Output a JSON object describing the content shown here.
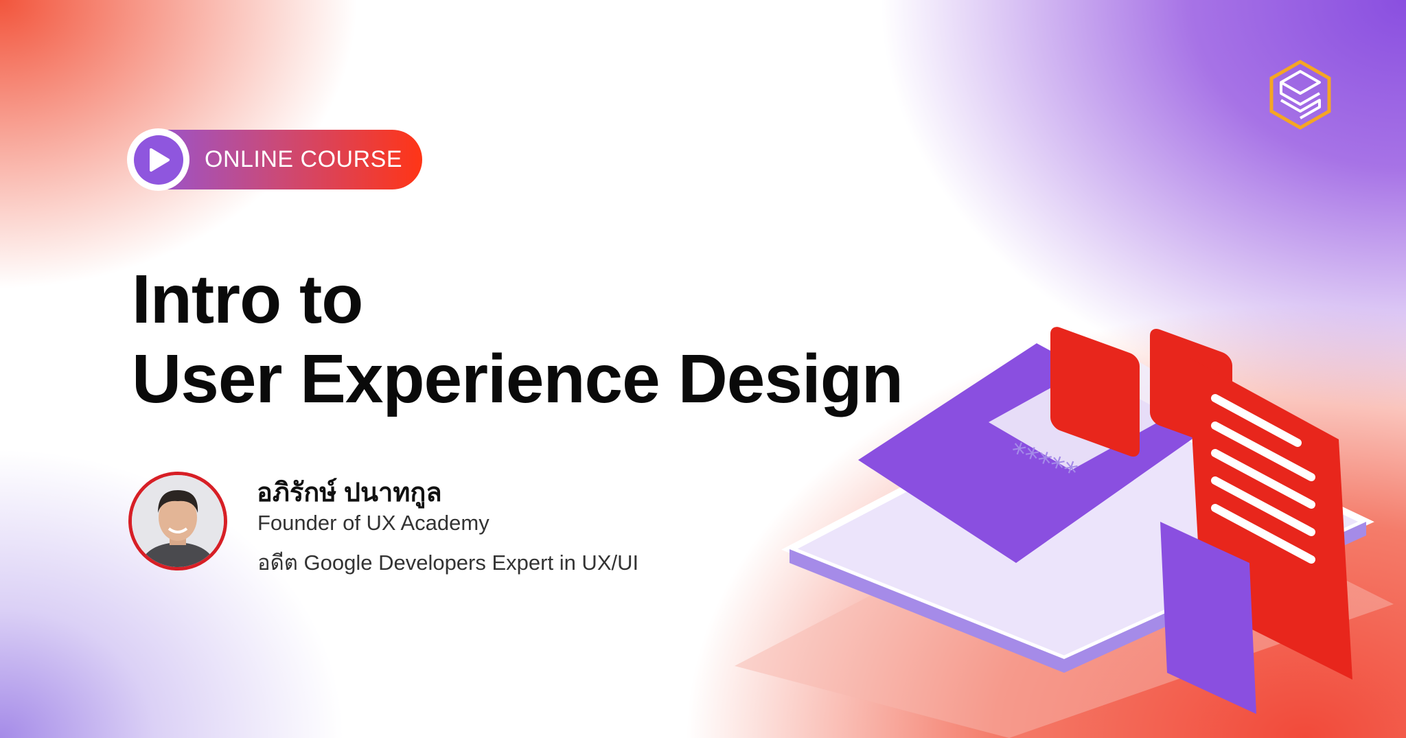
{
  "badge": {
    "label": "ONLINE COURSE",
    "icon": "play-icon"
  },
  "title": {
    "line1": "Intro to",
    "line2": "User Experience Design"
  },
  "instructor": {
    "name": "อภิรักษ์ ปนาทกูล",
    "role1": "Founder of UX Academy",
    "role2": "อดีต Google Developers Expert in UX/UI"
  },
  "illustration": {
    "password_mask": "*****"
  },
  "colors": {
    "accent_purple": "#8f56de",
    "accent_red": "#ff3516",
    "logo_orange": "#f5a623"
  }
}
